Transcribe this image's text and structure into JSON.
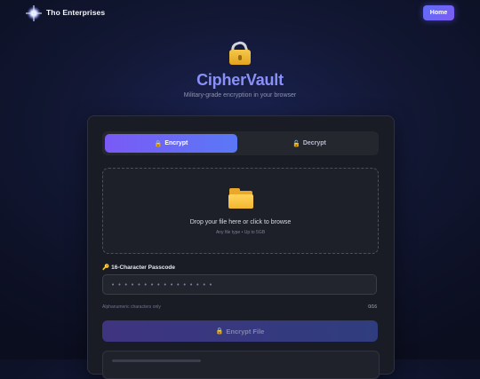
{
  "header": {
    "brand": "Tho Enterprises",
    "home_label": "Home"
  },
  "hero": {
    "icon": "padlock-icon",
    "title": "CipherVault",
    "subtitle": "Military-grade encryption in your browser"
  },
  "tabs": [
    {
      "label": "Encrypt",
      "icon": "lock-icon",
      "active": true
    },
    {
      "label": "Decrypt",
      "icon": "unlock-icon",
      "active": false
    }
  ],
  "dropzone": {
    "icon": "folder-icon",
    "text": "Drop your file here or click to browse",
    "hint": "Any file type • Up to 5GB"
  },
  "passcode": {
    "label": "16-Character Passcode",
    "icon": "key-icon",
    "placeholder": "••••••••••••••••",
    "value": "",
    "hint": "Alphanumeric characters only",
    "counter": "0/16"
  },
  "action": {
    "label": "Encrypt File",
    "icon": "lock-icon",
    "disabled": true
  },
  "colors": {
    "accent": "#7a5af5",
    "accent_2": "#5a78f6",
    "title": "#8b8ff8",
    "card_bg": "#1a1c25",
    "folder": "#f3b531"
  }
}
